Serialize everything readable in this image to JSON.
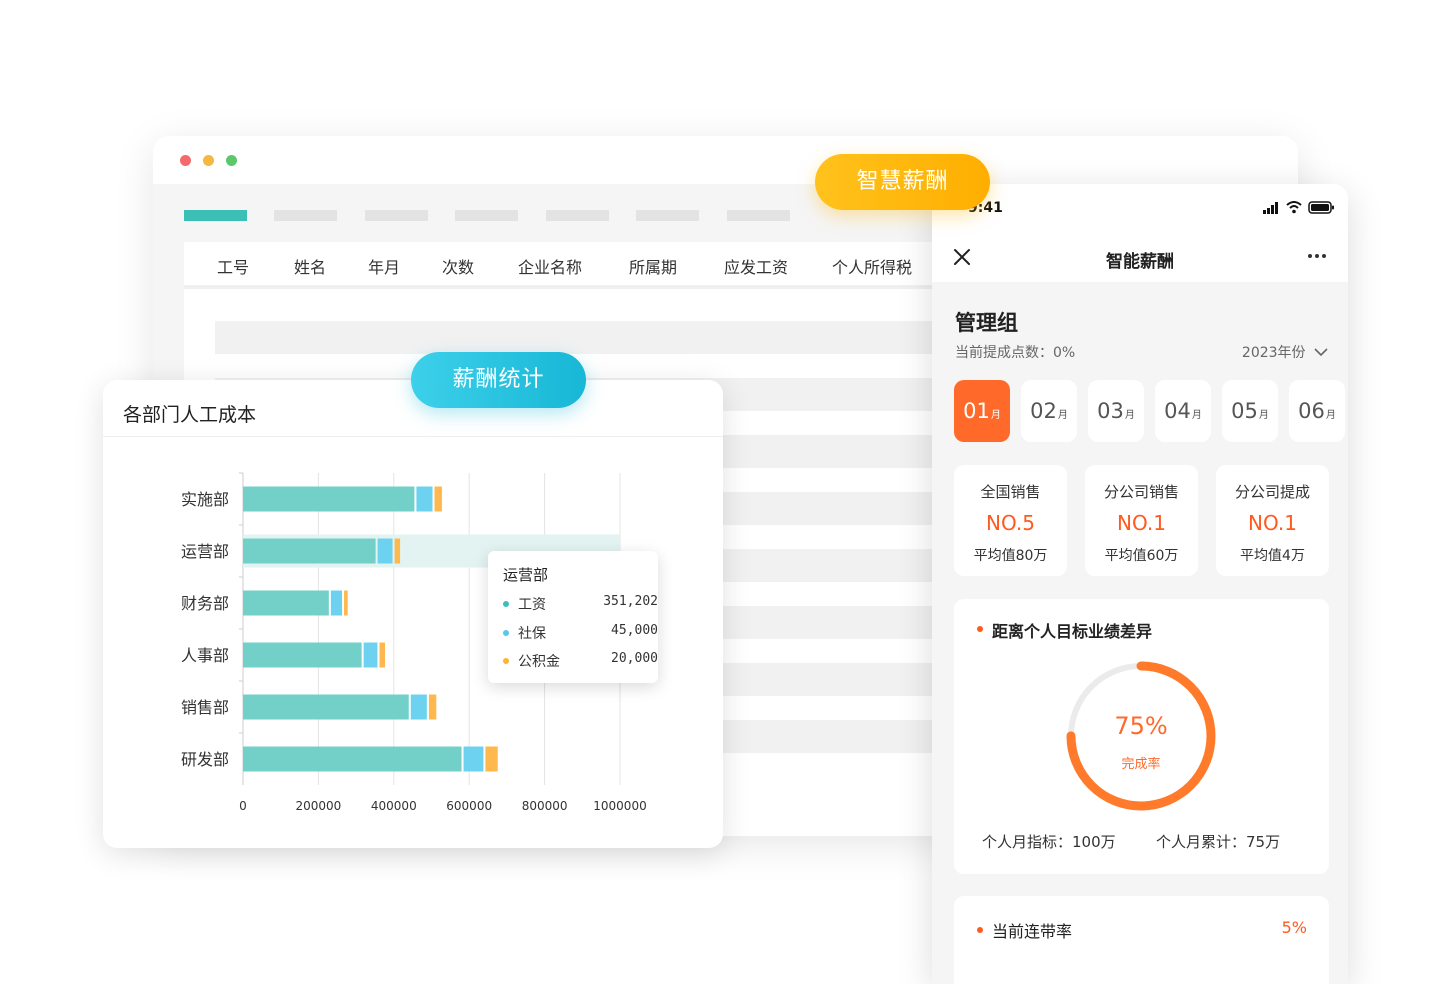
{
  "browser": {
    "tabs_count": 7,
    "table_headers": [
      "工号",
      "姓名",
      "年月",
      "次数",
      "企业名称",
      "所属期",
      "应发工资",
      "个人所得税"
    ]
  },
  "badges": {
    "salary_stats": "薪酬统计",
    "smart_salary": "智慧薪酬"
  },
  "chart_card": {
    "title": "各部门人工成本"
  },
  "chart_data": {
    "type": "bar",
    "orientation": "horizontal",
    "stacked": true,
    "title": "各部门人工成本",
    "categories": [
      "实施部",
      "运营部",
      "财务部",
      "人事部",
      "销售部",
      "研发部"
    ],
    "series": [
      {
        "name": "工资",
        "color": "#72d0c8",
        "values": [
          460000,
          357000,
          233000,
          320000,
          445000,
          585000
        ]
      },
      {
        "name": "社保",
        "color": "#6cd2f0",
        "values": [
          48000,
          45000,
          35000,
          42000,
          48000,
          58000
        ]
      },
      {
        "name": "公积金",
        "color": "#ffb84d",
        "values": [
          25000,
          20000,
          15000,
          20000,
          25000,
          38000
        ]
      }
    ],
    "x_ticks": [
      "0",
      "200000",
      "400000",
      "600000",
      "800000",
      "1000000"
    ],
    "xlim": [
      0,
      1000000
    ],
    "grid": true,
    "highlight_index": 1,
    "tooltip": {
      "title": "运营部",
      "rows": [
        {
          "label": "工资",
          "value": "351,202",
          "color": "#3bbfb6"
        },
        {
          "label": "社保",
          "value": "45,000",
          "color": "#57c8ec"
        },
        {
          "label": "公积金",
          "value": "20,000",
          "color": "#ffb330"
        }
      ]
    }
  },
  "phone": {
    "status_time": "9:41",
    "nav_title": "智能薪酬",
    "group_title": "管理组",
    "commission_label": "当前提成点数：0%",
    "year_label": "2023年份",
    "months": [
      {
        "num": "01",
        "unit": "月",
        "active": true
      },
      {
        "num": "02",
        "unit": "月",
        "active": false
      },
      {
        "num": "03",
        "unit": "月",
        "active": false
      },
      {
        "num": "04",
        "unit": "月",
        "active": false
      },
      {
        "num": "05",
        "unit": "月",
        "active": false
      },
      {
        "num": "06",
        "unit": "月",
        "active": false
      }
    ],
    "rank_cards": [
      {
        "label": "全国销售",
        "value": "NO.5",
        "avg": "平均值80万"
      },
      {
        "label": "分公司销售",
        "value": "NO.1",
        "avg": "平均值60万"
      },
      {
        "label": "分公司提成",
        "value": "NO.1",
        "avg": "平均值4万"
      }
    ],
    "goal": {
      "title": "距离个人目标业绩差异",
      "percent_text": "75%",
      "percent": 0.75,
      "rate_label": "完成率",
      "monthly_target": "个人月指标：100万",
      "monthly_total": "个人月累计：75万"
    },
    "bottom": {
      "title": "当前连带率",
      "value": "5%"
    },
    "accent": "#ff5a1f"
  }
}
